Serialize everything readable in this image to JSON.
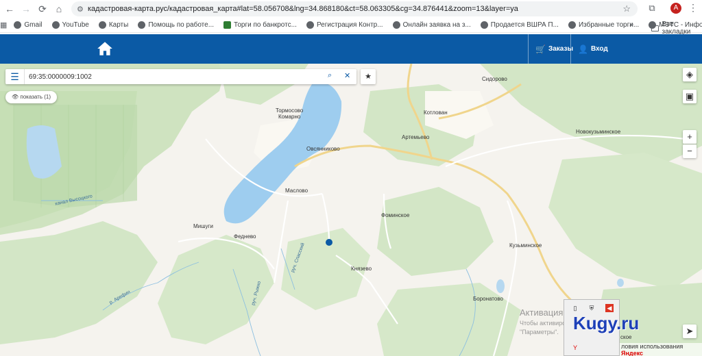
{
  "browser": {
    "url": "кадастровая-карта.рус/кадастровая_карта#lat=58.056708&lng=34.868180&ct=58.063305&cg=34.876441&zoom=13&layer=ya",
    "avatar_letter": "А",
    "bookmarks": [
      {
        "label": "Gmail"
      },
      {
        "label": "YouTube"
      },
      {
        "label": "Карты"
      },
      {
        "label": "Помощь по работе..."
      },
      {
        "label": "Торги по банкротс..."
      },
      {
        "label": "Регистрация Контр..."
      },
      {
        "label": "Онлайн заявка на з..."
      },
      {
        "label": "Продается ВШРА П..."
      },
      {
        "label": "Избранные торги..."
      },
      {
        "label": "МЭТС - Информац..."
      }
    ],
    "all_bookmarks": "Все закладки"
  },
  "header": {
    "orders_label": "Заказы",
    "login_label": "Вход",
    "brand_color": "#0b5aa5"
  },
  "search": {
    "value": "69:35:0000009:1002",
    "show_label": "показать (1)"
  },
  "map": {
    "places": {
      "sidorovo": "Сидорово",
      "tormosovo": "Тормосово",
      "komarno": "Комарно",
      "kotlovan": "Котлован",
      "artemevo": "Артемьево",
      "novokuzminskoe": "Новокузьминское",
      "ovsyannikovo": "Овсянниково",
      "maslovo": "Маслово",
      "fominskoe": "Фоминское",
      "mishugi": "Мишуги",
      "fednevo": "Феднево",
      "kuzminskoe": "Кузьминское",
      "knyazevo": "Князево",
      "boronatovo": "Боронатово",
      "canal": "канал Высоцкого",
      "river_spasskii": "руч. Спасский",
      "river_ryzhko": "руч. Рыжко",
      "river_arefin": "р. Арефин"
    },
    "footer_terms": "ловия использования",
    "footer_brand": "Яндекс"
  },
  "overlay": {
    "activation_title": "Активация W",
    "activation_sub1": "Чтобы активиро",
    "activation_sub2": "\"Параметры\".",
    "watermark": "Kugy.ru",
    "partial_place": "ское"
  }
}
